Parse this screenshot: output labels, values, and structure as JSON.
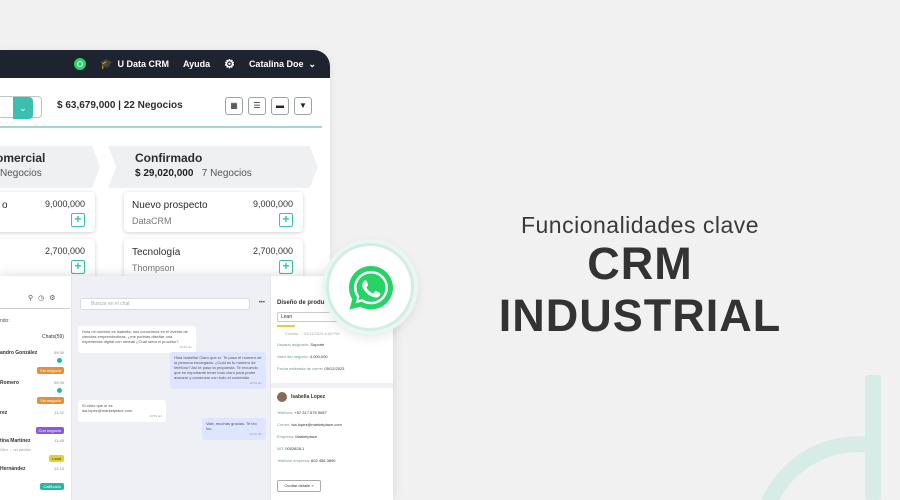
{
  "topbar": {
    "brand_label": "U Data CRM",
    "help_label": "Ayuda",
    "user_name": "Catalina Doe"
  },
  "pipeline": {
    "summary": "$ 63,679,000 | 22 Negocios",
    "stages": [
      {
        "title": "omercial",
        "sub_amount": "",
        "sub_count": "Negocios",
        "cards": [
          {
            "name": "o",
            "org": "",
            "amount": "9,000,000"
          },
          {
            "name": "",
            "org": "",
            "amount": "2,700,000"
          }
        ]
      },
      {
        "title": "Confirmado",
        "sub_amount": "$ 29,020,000",
        "sub_count": "7 Negocios",
        "cards": [
          {
            "name": "Nuevo prospecto",
            "org": "DataCRM",
            "amount": "9,000,000"
          },
          {
            "name": "Tecnología",
            "org": "Thompson",
            "amount": "2,700,000"
          }
        ]
      }
    ]
  },
  "chat": {
    "list_label": "ndo:",
    "tab_label": "Chats(59)",
    "items": [
      {
        "name": "andro González",
        "time": "09:30",
        "preview": "",
        "tag": "Sin negocio",
        "tag_color": "#e0913a"
      },
      {
        "name": "Romero",
        "time": "09:30",
        "preview": "",
        "tag": "Sin negocio",
        "tag_color": "#e0913a"
      },
      {
        "name": "rez",
        "time": "11:32",
        "preview": "",
        "tag": "Con negocio",
        "tag_color": "#8a5bd6"
      },
      {
        "name": "tina Martínez",
        "time": "11:45",
        "preview": "Otro ... un pedido",
        "tag": "Lead",
        "tag_color": "#e5cf35"
      },
      {
        "name": "Hernández",
        "time": "12:15",
        "preview": "",
        "tag": "Calificado",
        "tag_color": "#2bb5a5"
      }
    ],
    "search_placeholder": "Buscar en el chat",
    "messages": [
      {
        "dir": "in",
        "text": "Hola mi nombre es Isabella, nos conocimos en el evento de ciencias emprendedoras, ¿me podrías diseñar una experiencia digital con urbelat ¿Cuál sería el proceso?",
        "time": "10:52 am"
      },
      {
        "dir": "out",
        "text": "Hola Isabella! Claro que sí. Te paso el número de la persona encargada. ¿Cuál es tu número de teléfono? Así te paso la propuesta. Te recuerdo que es importante tener todo claro para poder avanzar y comenzar con todo el contenido.",
        "time": "10:54 am"
      },
      {
        "dir": "in",
        "text": "Si claro que sí es isa.lopez@marketplace.com",
        "time": "10:59 am"
      },
      {
        "dir": "out",
        "text": "Vale, muchas gracias. Te leo loo",
        "time": "11:00 am"
      }
    ]
  },
  "detail": {
    "title": "Diseño de producto",
    "stage_value": "Lean",
    "note": "Creado ... 01/11/2023 8:00 PM",
    "fields": [
      {
        "label": "Usuario asignado:",
        "value": "Soporte"
      },
      {
        "label": "Valor del negocio:",
        "value": "4,000,000"
      },
      {
        "label": "Fecha estimada de cierre:",
        "value": "05/12/2023"
      }
    ],
    "contact_name": "Isabella Lopez",
    "contact_fields": [
      {
        "label": "Teléfono:",
        "value": "+57 317 575 9087"
      },
      {
        "label": "Correo:",
        "value": "isa.lopez@marketplace.com"
      },
      {
        "label": "Empresa:",
        "value": "Marketplace"
      },
      {
        "label": "NIT:",
        "value": "0002828-1"
      },
      {
        "label": "Teléfono empresa:",
        "value": "602 456 3890"
      }
    ],
    "button_label": "Ocultar detalle"
  },
  "headline": {
    "subtitle": "Funcionalidades clave",
    "title": "CRM INDUSTRIAL"
  },
  "colors": {
    "accent": "#3cbfae",
    "topbar": "#1e2330",
    "whatsapp": "#25d366",
    "background": "#f1f1f1"
  }
}
